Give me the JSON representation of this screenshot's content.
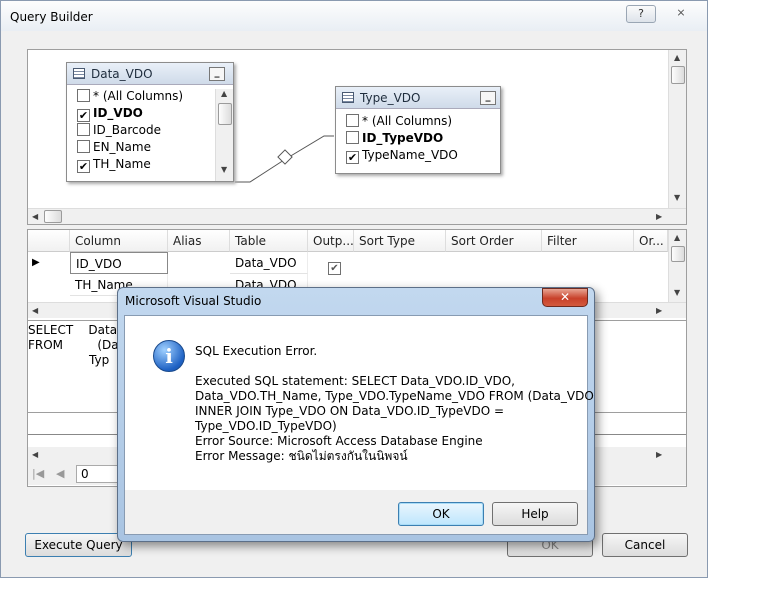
{
  "window": {
    "title": "Query Builder",
    "help_glyph": "?",
    "close_glyph": "⨯"
  },
  "diagram": {
    "tables": [
      {
        "title": "Data_VDO",
        "columns": [
          {
            "label": "* (All Columns)",
            "checked": false,
            "bold": false
          },
          {
            "label": "ID_VDO",
            "checked": true,
            "bold": true
          },
          {
            "label": "ID_Barcode",
            "checked": false,
            "bold": false
          },
          {
            "label": "EN_Name",
            "checked": false,
            "bold": false
          },
          {
            "label": "TH_Name",
            "checked": true,
            "bold": false
          }
        ]
      },
      {
        "title": "Type_VDO",
        "columns": [
          {
            "label": "* (All Columns)",
            "checked": false,
            "bold": false
          },
          {
            "label": "ID_TypeVDO",
            "checked": false,
            "bold": true
          },
          {
            "label": "TypeName_VDO",
            "checked": true,
            "bold": false
          }
        ]
      }
    ]
  },
  "grid": {
    "headers": [
      "Column",
      "Alias",
      "Table",
      "Outp...",
      "Sort Type",
      "Sort Order",
      "Filter",
      "Or..."
    ],
    "rows": [
      {
        "column": "ID_VDO",
        "alias": "",
        "table": "Data_VDO",
        "output": true
      },
      {
        "column": "TH_Name",
        "alias": "",
        "table": "Data_VDO",
        "output": true
      }
    ]
  },
  "sql_pane": {
    "line1": "SELECT    Data_",
    "line2": "FROM         (Dat",
    "line3": "                Typ"
  },
  "results": {
    "record_value": "0"
  },
  "buttons": {
    "execute_query": "Execute Query",
    "ok": "OK",
    "cancel": "Cancel"
  },
  "modal": {
    "title": "Microsoft Visual Studio",
    "close_glyph": "✕",
    "icon_glyph": "i",
    "heading": "SQL Execution Error.",
    "details": [
      "Executed SQL statement: SELECT Data_VDO.ID_VDO,",
      "Data_VDO.TH_Name, Type_VDO.TypeName_VDO FROM (Data_VDO",
      "INNER JOIN Type_VDO ON Data_VDO.ID_TypeVDO =",
      "Type_VDO.ID_TypeVDO)",
      "Error Source: Microsoft Access Database Engine",
      "Error Message: ชนิดไม่ตรงกันในนิพจน์"
    ],
    "ok_label": "OK",
    "help_label": "Help"
  }
}
